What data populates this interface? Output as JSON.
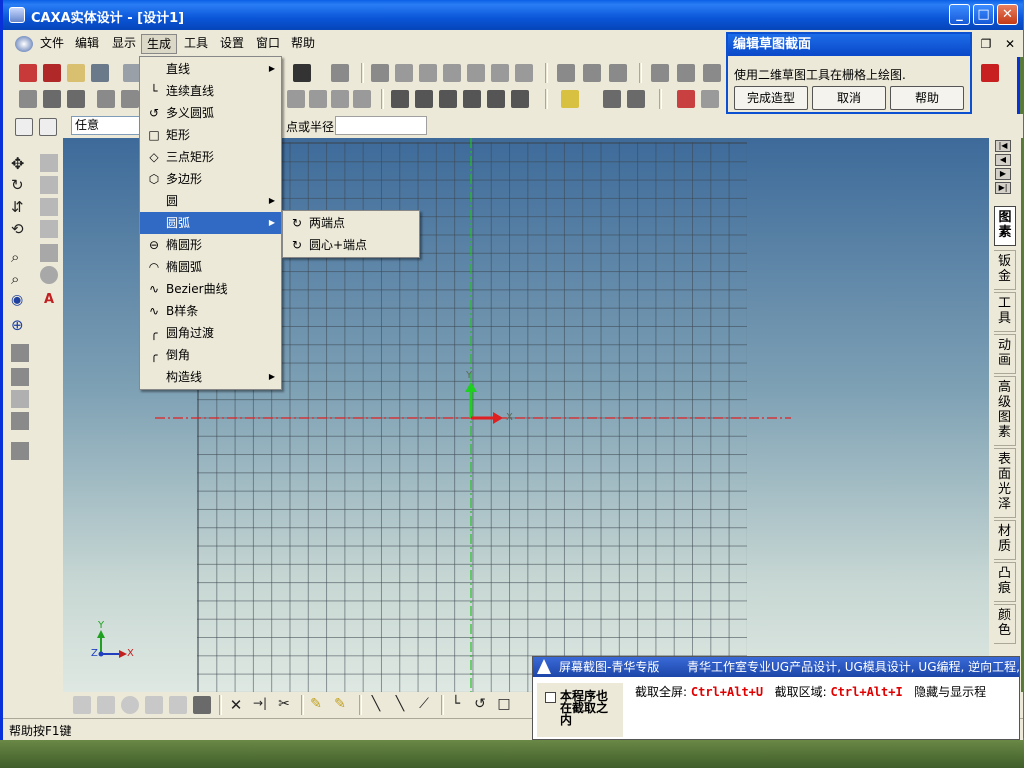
{
  "window": {
    "title": "CAXA实体设计 - [设计1]"
  },
  "menubar": {
    "items": [
      "文件",
      "编辑",
      "显示",
      "生成",
      "工具",
      "设置",
      "窗口",
      "帮助"
    ]
  },
  "generate_menu": {
    "items": [
      {
        "label": "直线",
        "icon": "line-icon",
        "submenu": true
      },
      {
        "label": "连续直线",
        "icon": "polyline-icon",
        "submenu": false
      },
      {
        "label": "多义圆弧",
        "icon": "multi-arc-icon",
        "submenu": false
      },
      {
        "label": "矩形",
        "icon": "rectangle-icon",
        "submenu": false
      },
      {
        "label": "三点矩形",
        "icon": "three-point-rect-icon",
        "submenu": false
      },
      {
        "label": "多边形",
        "icon": "polygon-icon",
        "submenu": false
      },
      {
        "label": "圆",
        "icon": "circle-icon",
        "submenu": true
      },
      {
        "label": "圆弧",
        "icon": "arc-icon",
        "submenu": true,
        "highlighted": true
      },
      {
        "label": "椭圆形",
        "icon": "ellipse-icon",
        "submenu": false
      },
      {
        "label": "椭圆弧",
        "icon": "elliptic-arc-icon",
        "submenu": false
      },
      {
        "label": "Bezier曲线",
        "icon": "bezier-icon",
        "submenu": false
      },
      {
        "label": "B样条",
        "icon": "bspline-icon",
        "submenu": false
      },
      {
        "label": "圆角过渡",
        "icon": "fillet-icon",
        "submenu": false
      },
      {
        "label": "倒角",
        "icon": "chamfer-icon",
        "submenu": false
      },
      {
        "label": "构造线",
        "icon": "construction-line-icon",
        "submenu": true
      }
    ]
  },
  "arc_submenu": {
    "items": [
      {
        "label": "两端点",
        "icon": "two-endpoint-arc-icon"
      },
      {
        "label": "圆心+端点",
        "icon": "center-endpoint-arc-icon"
      }
    ]
  },
  "sketch_dialog": {
    "title": "编辑草图截面",
    "message": "使用二维草图工具在栅格上绘图.",
    "buttons": [
      "完成造型",
      "取消",
      "帮助"
    ]
  },
  "param_bar": {
    "select_value": "任意",
    "label": "点或半径:",
    "input_value": ""
  },
  "right_tabs": [
    "图素",
    "钣金",
    "工具",
    "动画",
    "高级图素",
    "表面光泽",
    "材质",
    "凸痕",
    "颜色"
  ],
  "canvas": {
    "axis_x": "X",
    "axis_y": "Y",
    "axis_z": "Z",
    "mini_axis_y": "Y",
    "mini_axis_z": "Z",
    "mini_axis_x": "X"
  },
  "status_bar": {
    "text": "帮助按F1键"
  },
  "capture_tool": {
    "title": "屏幕截图-青华专版",
    "subtitle": "青华工作室专业UG产品设计, UG模具设计, UG编程, 逆向工程, 服务",
    "note": "本程序也在截取之内",
    "full_label": "截取全屏:",
    "full_shortcut": "Ctrl+Alt+U",
    "region_label": "截取区域:",
    "region_shortcut": "Ctrl+Alt+I",
    "hide_label": "隐藏与显示程"
  },
  "colors": {
    "title_bar": "#0a56d8",
    "menu_highlight": "#316ac5",
    "axis_x": "#e02020",
    "axis_y": "#20c020",
    "dashed_line": "#e02020"
  }
}
